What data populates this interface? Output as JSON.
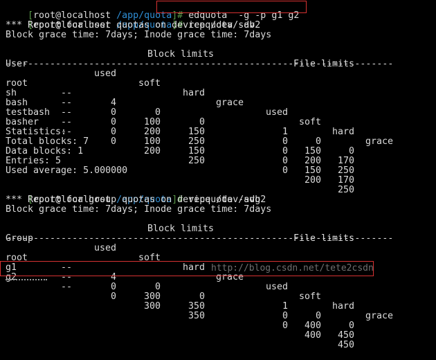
{
  "prompt": {
    "open": "[",
    "userhost": "root@localhost",
    "path": "/app/quota",
    "close": "]#"
  },
  "commands": {
    "c1": "edquota  -g -p g1 g2",
    "c2": "repquota -av",
    "c3": "repquota -avg"
  },
  "user_report": {
    "title": "*** Report for user quotas on device /dev/sdb2",
    "grace": "Block grace time: 7days; Inode grace time: 7days",
    "block_limits": "Block limits",
    "file_limits": "File limits",
    "headers": [
      "User",
      "used",
      "soft",
      "hard",
      "grace",
      "used",
      "soft",
      "hard",
      "grace"
    ],
    "separator": "----------------------------------------------------------------------",
    "rows": [
      {
        "name": "root",
        "flags": "--",
        "bused": "4",
        "bsoft": "0",
        "bhard": "0",
        "fused": "1",
        "fsoft": "0",
        "fhard": "0"
      },
      {
        "name": "sh",
        "flags": "--",
        "bused": "0",
        "bsoft": "100",
        "bhard": "150",
        "fused": "0",
        "fsoft": "150",
        "fhard": "170"
      },
      {
        "name": "bash",
        "flags": "--",
        "bused": "0",
        "bsoft": "200",
        "bhard": "250",
        "fused": "0",
        "fsoft": "200",
        "fhard": "250"
      },
      {
        "name": "testbash",
        "flags": "--",
        "bused": "0",
        "bsoft": "100",
        "bhard": "150",
        "fused": "0",
        "fsoft": "150",
        "fhard": "170"
      },
      {
        "name": "basher",
        "flags": "--",
        "bused": "0",
        "bsoft": "200",
        "bhard": "250",
        "fused": "0",
        "fsoft": "200",
        "fhard": "250"
      }
    ]
  },
  "statistics": {
    "heading": "Statistics:",
    "total_blocks": "Total blocks: 7",
    "data_blocks": "Data blocks: 1",
    "entries": "Entries: 5",
    "used_average": "Used average: 5.000000"
  },
  "group_report": {
    "title": "*** Report for group quotas on device /dev/sdb2",
    "grace": "Block grace time: 7days; Inode grace time: 7days",
    "block_limits": "Block limits",
    "file_limits": "File limits",
    "headers": [
      "Group",
      "used",
      "soft",
      "hard",
      "grace",
      "used",
      "soft",
      "hard",
      "grace"
    ],
    "separator": "----------------------------------------------------------------------",
    "rows": [
      {
        "name": "root",
        "flags": "--",
        "bused": "4",
        "bsoft": "0",
        "bhard": "0",
        "fused": "1",
        "fsoft": "0",
        "fhard": "0"
      },
      {
        "name": "g1",
        "flags": "--",
        "bused": "0",
        "bsoft": "300",
        "bhard": "350",
        "fused": "0",
        "fsoft": "400",
        "fhard": "450"
      },
      {
        "name": "g2",
        "flags": "--",
        "bused": "0",
        "bsoft": "300",
        "bhard": "350",
        "fused": "0",
        "fsoft": "400",
        "fhard": "450"
      }
    ]
  },
  "watermark": "http://blog.csdn.net/tete2csdn",
  "colors": {
    "background": "#000000",
    "text": "#dcdcdc",
    "bracket": "#5a9a4a",
    "path": "#2f8fd6",
    "highlight": "#d83232"
  }
}
